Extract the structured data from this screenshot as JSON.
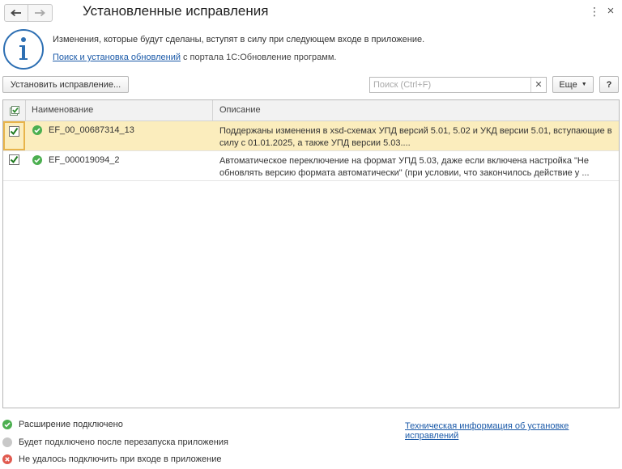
{
  "window": {
    "title": "Установленные исправления"
  },
  "info": {
    "message": "Изменения, которые будут сделаны, вступят в силу при следующем входе в приложение.",
    "link": "Поиск и установка обновлений",
    "link_suffix": "с портала 1С:Обновление программ."
  },
  "toolbar": {
    "install_label": "Установить исправление...",
    "search_placeholder": "Поиск (Ctrl+F)",
    "search_value": "",
    "more_label": "Еще",
    "help_label": "?"
  },
  "table": {
    "columns": [
      "Наименование",
      "Описание"
    ],
    "rows": [
      {
        "checked": true,
        "status": "connected",
        "name": "EF_00_00687314_13",
        "description_line1": "Поддержаны изменения в xsd-схемах УПД версий 5.01, 5.02 и УКД версии 5.01, вступающие в",
        "description_line2": "силу с 01.01.2025, а также УПД версии 5.03...."
      },
      {
        "checked": true,
        "status": "connected",
        "name": "EF_000019094_2",
        "description_line1": "Автоматическое переключение на формат УПД 5.03, даже если включена настройка \"Не",
        "description_line2": "обновлять версию формата автоматически\" (при условии, что закончилось действие у ..."
      }
    ]
  },
  "legend": {
    "connected": "Расширение подключено",
    "pending": "Будет подключено после перезапуска приложения",
    "failed": "Не удалось подключить при входе в приложение"
  },
  "tech_link": "Техническая информация об установке исправлений",
  "colors": {
    "selected_row": "#fbedbd",
    "link": "#1a59a8",
    "status_ok": "#4caf50",
    "status_pending": "#c8c8c8",
    "status_error": "#e05a4f",
    "info_icon": "#2d6fb3"
  }
}
